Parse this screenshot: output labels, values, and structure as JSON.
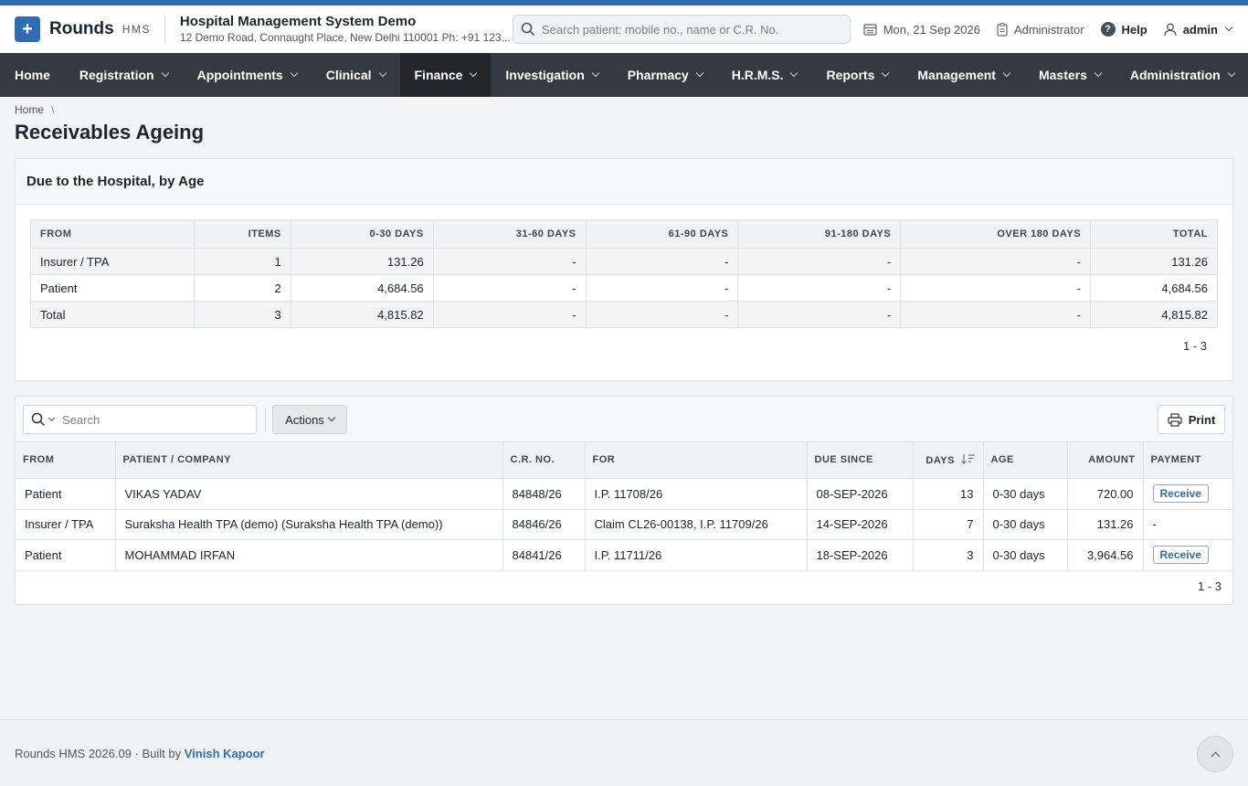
{
  "header": {
    "logo_name": "Rounds",
    "logo_sub": "HMS",
    "hospital_name": "Hospital Management System Demo",
    "hospital_address": "12 Demo Road, Connaught Place, New Delhi 110001 Ph: +91 123...",
    "search_placeholder": "Search patient: mobile no., name or C.R. No.",
    "date": "Mon, 21 Sep 2026",
    "role": "Administrator",
    "help": "Help",
    "user": "admin"
  },
  "nav": [
    "Home",
    "Registration",
    "Appointments",
    "Clinical",
    "Finance",
    "Investigation",
    "Pharmacy",
    "H.R.M.S.",
    "Reports",
    "Management",
    "Masters",
    "Administration"
  ],
  "breadcrumb": "Home",
  "page_title": "Receivables Ageing",
  "ageing": {
    "title": "Due to the Hospital, by Age",
    "headers": [
      "FROM",
      "ITEMS",
      "0-30 DAYS",
      "31-60 DAYS",
      "61-90 DAYS",
      "91-180 DAYS",
      "OVER 180 DAYS",
      "TOTAL"
    ],
    "rows": [
      [
        "Insurer / TPA",
        "1",
        "131.26",
        "-",
        "-",
        "-",
        "-",
        "131.26"
      ],
      [
        "Patient",
        "2",
        "4,684.56",
        "-",
        "-",
        "-",
        "-",
        "4,684.56"
      ],
      [
        "Total",
        "3",
        "4,815.82",
        "-",
        "-",
        "-",
        "-",
        "4,815.82"
      ]
    ],
    "count": "1 - 3"
  },
  "list": {
    "search_placeholder": "Search",
    "actions_label": "Actions",
    "print_label": "Print",
    "headers": [
      "FROM",
      "PATIENT / COMPANY",
      "C.R. NO.",
      "FOR",
      "DUE SINCE",
      "DAYS",
      "AGE",
      "AMOUNT",
      "PAYMENT"
    ],
    "rows": [
      [
        "Patient",
        "VIKAS YADAV",
        "84848/26",
        "I.P. 11708/26",
        "08-SEP-2026",
        "13",
        "0-30 days",
        "720.00",
        "Receive"
      ],
      [
        "Insurer / TPA",
        "Suraksha Health TPA (demo) (Suraksha Health TPA (demo))",
        "84846/26",
        "Claim CL26-00138, I.P. 11709/26",
        "14-SEP-2026",
        "7",
        "0-30 days",
        "131.26",
        "-"
      ],
      [
        "Patient",
        "MOHAMMAD IRFAN",
        "84841/26",
        "I.P. 11711/26",
        "18-SEP-2026",
        "3",
        "0-30 days",
        "3,964.56",
        "Receive"
      ]
    ],
    "count": "1 - 3"
  },
  "footer": {
    "text": "Rounds HMS 2026.09 · Built by",
    "author": "Vinish Kapoor"
  }
}
